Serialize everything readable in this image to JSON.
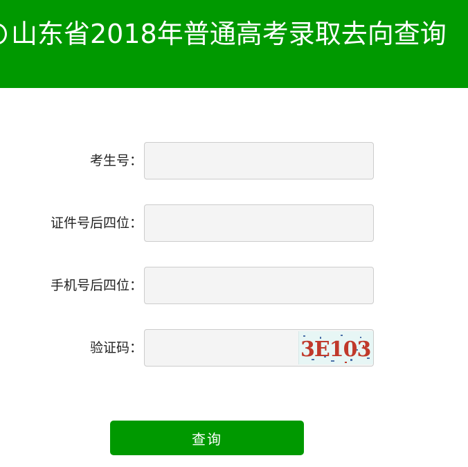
{
  "header": {
    "title": "山东省2018年普通高考录取去向查询",
    "background_color": "#009900",
    "logo_icon": "circle-emblem-icon"
  },
  "form": {
    "fields": [
      {
        "label": "考生号：",
        "value": "",
        "placeholder": ""
      },
      {
        "label": "证件号后四位：",
        "value": "",
        "placeholder": ""
      },
      {
        "label": "手机号后四位：",
        "value": "",
        "placeholder": ""
      },
      {
        "label": "验证码：",
        "value": "",
        "placeholder": ""
      }
    ],
    "captcha_text": "3E103"
  },
  "submit": {
    "label": "查询",
    "color": "#009900"
  }
}
